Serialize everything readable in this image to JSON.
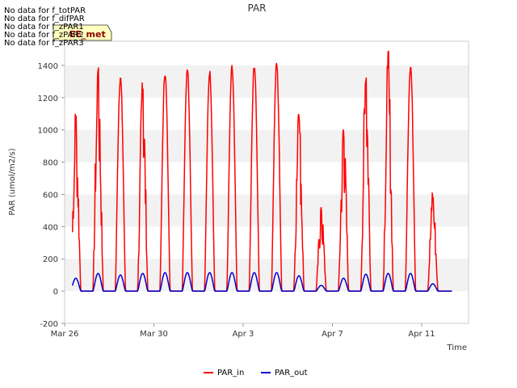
{
  "chart_data": {
    "type": "line",
    "title": "PAR",
    "xlabel": "Time",
    "ylabel": "PAR (umol/m2/s)",
    "ylim": [
      -200,
      1550
    ],
    "yticks": [
      -200,
      0,
      200,
      400,
      600,
      800,
      1000,
      1200,
      1400
    ],
    "xlim_days": [
      0,
      18.1
    ],
    "xticks": [
      {
        "day": 0,
        "label": "Mar 26"
      },
      {
        "day": 4,
        "label": "Mar 30"
      },
      {
        "day": 8,
        "label": "Apr 3"
      },
      {
        "day": 12,
        "label": "Apr 7"
      },
      {
        "day": 16,
        "label": "Apr 11"
      }
    ],
    "grid": "horizontal bands",
    "legend": "bottom-center",
    "series": [
      {
        "name": "PAR_in",
        "color": "#ff0000",
        "daily_peaks": [
          1110,
          1450,
          1345,
          1340,
          1375,
          1405,
          1380,
          1405,
          1420,
          1430,
          1165,
          520,
          1040,
          1420,
          1510,
          1420,
          625
        ],
        "daily_shape": [
          "spiky",
          "spiky",
          "smooth",
          "spiky",
          "smooth",
          "smooth",
          "smooth",
          "smooth",
          "smooth",
          "smooth",
          "spiky",
          "spiky",
          "spiky",
          "spiky",
          "spiky",
          "smooth",
          "spiky"
        ]
      },
      {
        "name": "PAR_out",
        "color": "#0000cc",
        "daily_peaks": [
          80,
          110,
          100,
          110,
          115,
          115,
          115,
          115,
          115,
          115,
          95,
          35,
          80,
          105,
          110,
          110,
          45
        ]
      }
    ],
    "x_start_day": 0.35,
    "x_end_day": 17.35
  },
  "nodata_lines": [
    "No data for f_totPAR",
    "No data for f_difPAR",
    "No data for f_zPAR1",
    "No data for f_zPAR2",
    "No data for f_zPAR3"
  ],
  "tooltip_label": "EE_met"
}
